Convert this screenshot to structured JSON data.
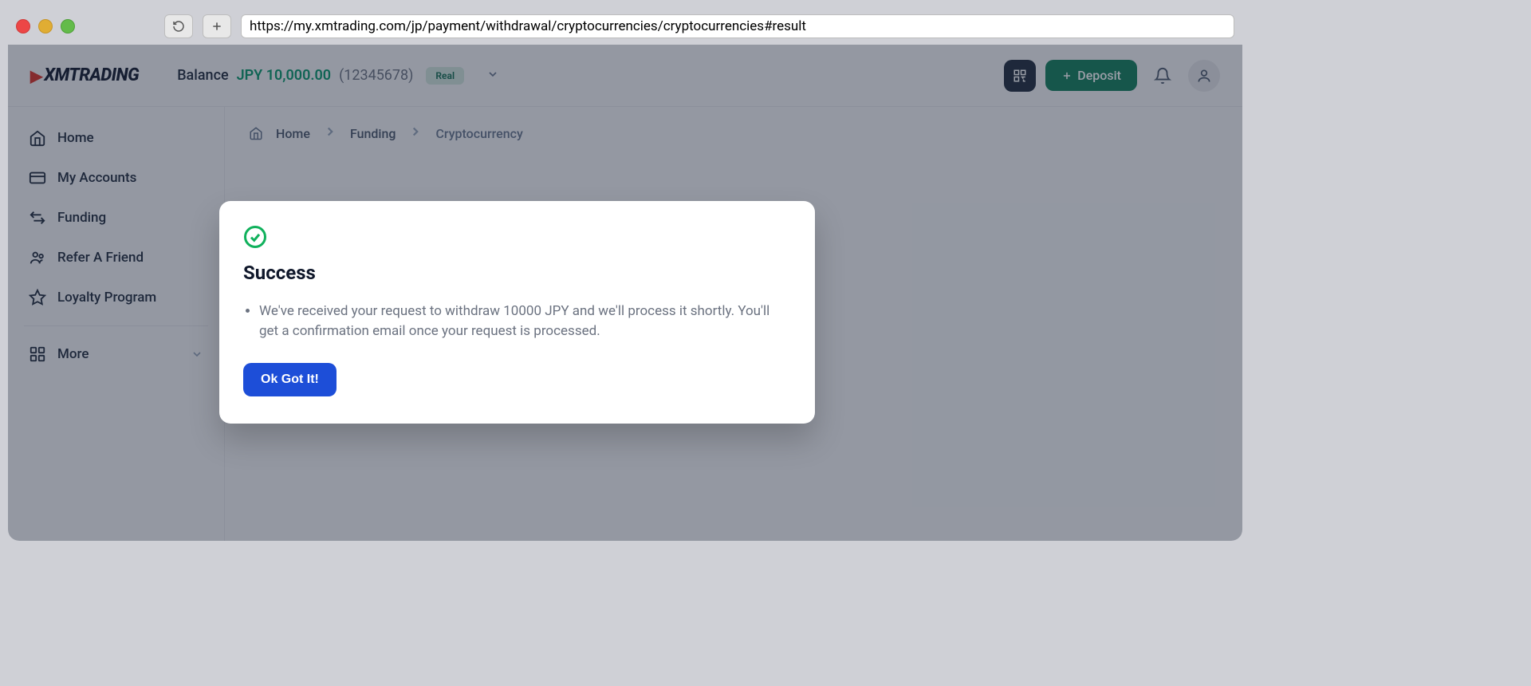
{
  "browser": {
    "url": "https://my.xmtrading.com/jp/payment/withdrawal/cryptocurrencies/cryptocurrencies#result"
  },
  "logo": {
    "text": "XMTRADING"
  },
  "header": {
    "balance_label": "Balance",
    "balance_value": "JPY 10,000.00",
    "account_id": "(12345678)",
    "badge": "Real",
    "deposit_label": "Deposit"
  },
  "sidebar": {
    "items": [
      {
        "label": "Home"
      },
      {
        "label": "My Accounts"
      },
      {
        "label": "Funding"
      },
      {
        "label": "Refer A Friend"
      },
      {
        "label": "Loyalty Program"
      }
    ],
    "more_label": "More"
  },
  "breadcrumb": {
    "home": "Home",
    "funding": "Funding",
    "crypto": "Cryptocurrency"
  },
  "modal": {
    "title": "Success",
    "message": "We've received your request to withdraw 10000 JPY and we'll process it shortly. You'll get a confirmation email once your request is processed.",
    "button": "Ok Got It!"
  }
}
